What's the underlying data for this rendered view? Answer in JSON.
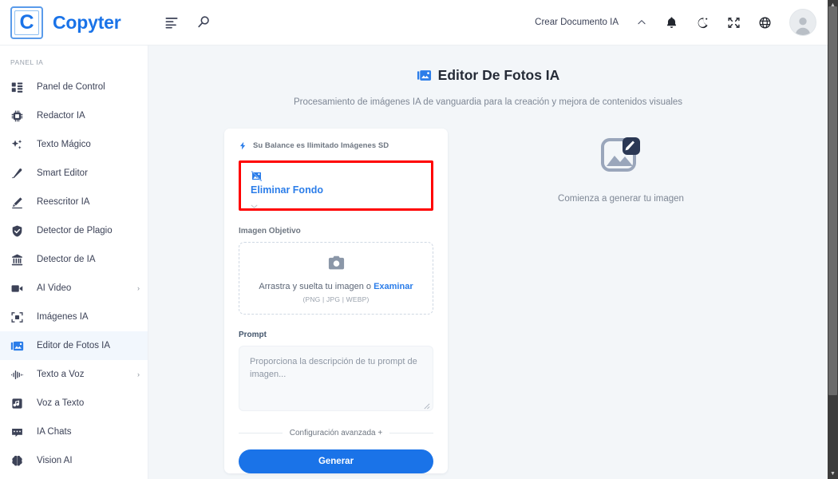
{
  "brand": {
    "mark": "C",
    "name": "Copyter"
  },
  "topbar": {
    "menu_icon": "menu-list-icon",
    "search_icon": "search-icon",
    "create_document_label": "Crear Documento IA",
    "chevron_icon": "chevron-up-icon",
    "notification_icon": "bell-icon",
    "theme_icon": "moon-icon",
    "fullscreen_icon": "compress-icon",
    "language_icon": "globe-icon",
    "avatar_icon": "user-avatar-icon"
  },
  "sidebar": {
    "section_label": "PANEL IA",
    "items": [
      {
        "label": "Panel de Control",
        "icon": "dashboard-icon",
        "active": false,
        "caret": ""
      },
      {
        "label": "Redactor IA",
        "icon": "chip-ai-icon",
        "active": false,
        "caret": ""
      },
      {
        "label": "Texto Mágico",
        "icon": "sparkles-icon",
        "active": false,
        "caret": ""
      },
      {
        "label": "Smart Editor",
        "icon": "pen-icon",
        "active": false,
        "caret": ""
      },
      {
        "label": "Reescritor IA",
        "icon": "pencil-edit-icon",
        "active": false,
        "caret": ""
      },
      {
        "label": "Detector de Plagio",
        "icon": "shield-check-icon",
        "active": false,
        "caret": ""
      },
      {
        "label": "Detector de IA",
        "icon": "bank-detector-icon",
        "active": false,
        "caret": ""
      },
      {
        "label": "AI Video",
        "icon": "video-camera-icon",
        "active": false,
        "caret": "›"
      },
      {
        "label": "Imágenes IA",
        "icon": "image-focus-icon",
        "active": false,
        "caret": ""
      },
      {
        "label": "Editor de Fotos IA",
        "icon": "photo-editor-icon",
        "active": true,
        "caret": ""
      },
      {
        "label": "Texto a Voz",
        "icon": "waveform-icon",
        "active": false,
        "caret": "›"
      },
      {
        "label": "Voz a Texto",
        "icon": "music-note-box-icon",
        "active": false,
        "caret": ""
      },
      {
        "label": "IA Chats",
        "icon": "chat-bubble-icon",
        "active": false,
        "caret": ""
      },
      {
        "label": "Vision AI",
        "icon": "brain-icon",
        "active": false,
        "caret": ""
      }
    ]
  },
  "page": {
    "title": "Editor De Fotos IA",
    "title_icon": "photo-editor-icon",
    "subtitle": "Procesamiento de imágenes IA de vanguardia para la creación y mejora de contenidos visuales"
  },
  "form": {
    "balance_icon": "bolt-icon",
    "balance_text": "Su Balance es Ilimitado Imágenes SD",
    "tool_select": {
      "icon": "image-off-icon",
      "selected_value": "Eliminar Fondo",
      "chevron_icon": "chevron-down-icon",
      "highlight_color": "#ff0000"
    },
    "image_field": {
      "label": "Imagen Objetivo",
      "camera_icon": "camera-icon",
      "drop_text": "Arrastra y suelta tu imagen o ",
      "browse_link": "Examinar",
      "formats": "(PNG | JPG | WEBP)"
    },
    "prompt_field": {
      "label": "Prompt",
      "placeholder": "Proporciona la descripción de tu prompt de imagen...",
      "value": "",
      "resize_icon": "resize-grip-icon"
    },
    "advanced_label": "Configuración avanzada +",
    "generate_label": "Generar"
  },
  "preview": {
    "icon": "image-edit-placeholder-icon",
    "message": "Comienza a generar tu imagen"
  },
  "scrollbar": {
    "up_icon": "scroll-up-arrow-icon",
    "down_icon": "scroll-down-arrow-icon"
  },
  "colors": {
    "accent": "#1a73e8",
    "link": "#2b7de9",
    "page_bg": "#f3f6f9",
    "text": "#3c4257",
    "muted": "#7e8795",
    "highlight": "#ff0000"
  }
}
